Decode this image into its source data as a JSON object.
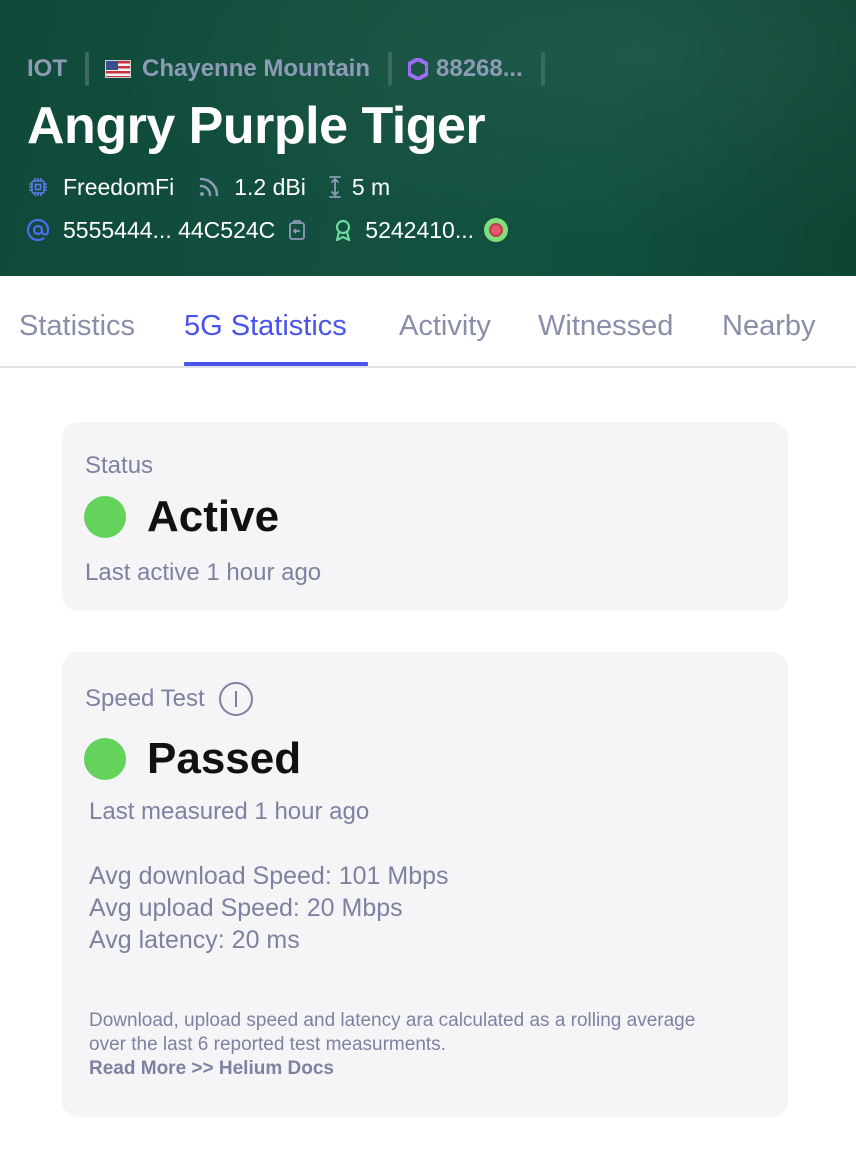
{
  "header": {
    "breadcrumb": {
      "network": "IOT",
      "location": "Chayenne Mountain",
      "hex": "88268..."
    },
    "title": "Angry Purple Tiger",
    "maker": "FreedomFi",
    "antenna_gain": "1.2 dBi",
    "elevation": "5 m",
    "address": "5555444... 44C524C",
    "owner": "5242410...",
    "icons": {
      "flag": "us-flag-icon",
      "hex": "hexagon-icon",
      "maker": "chip-icon",
      "gain": "signal-icon",
      "elevation": "height-icon",
      "address": "at-icon",
      "copy": "copy-icon",
      "owner": "user-badge-icon",
      "owner_avatar": "bullseye-icon"
    },
    "colors": {
      "background": "#13503f",
      "breadcrumb_text": "#8d9bb5",
      "hex_accent": "#9d6cf0",
      "address_accent": "#4d6cf3",
      "owner_accent": "#6ed9a0"
    }
  },
  "tabs": [
    {
      "label": "Statistics",
      "active": false
    },
    {
      "label": "5G Statistics",
      "active": true
    },
    {
      "label": "Activity",
      "active": false
    },
    {
      "label": "Witnessed",
      "active": false
    },
    {
      "label": "Nearby",
      "active": false
    }
  ],
  "tab_accent_color": "#4a54ea",
  "status_card": {
    "label": "Status",
    "value": "Active",
    "subtitle": "Last active 1 hour ago",
    "indicator_color": "#63d35c"
  },
  "speed_card": {
    "label": "Speed Test",
    "info_icon": "info-icon",
    "value": "Passed",
    "subtitle": "Last measured 1 hour ago",
    "indicator_color": "#63d35c",
    "stats": [
      "Avg download Speed: 101 Mbps",
      "Avg upload Speed: 20 Mbps",
      "Avg latency: 20 ms"
    ],
    "note": "Download, upload speed and latency ara calculated as a rolling average over the last 6 reported test measurments.",
    "read_more": "Read More >> Helium Docs"
  }
}
